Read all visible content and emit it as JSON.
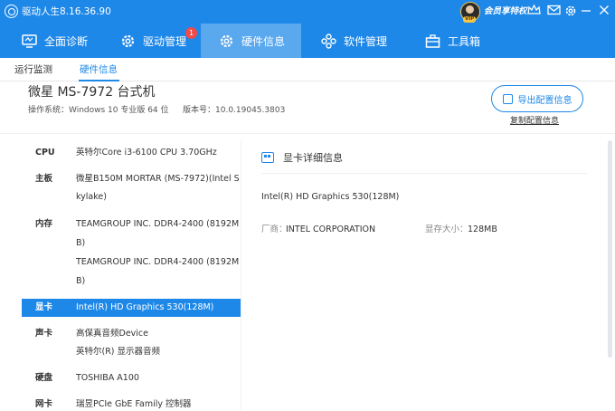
{
  "app": {
    "title": "驱动人生8.16.36.90",
    "member_label": "会员享特权",
    "vip_label": "VIP"
  },
  "window_icons": [
    "crown-icon",
    "mail-icon",
    "gear-icon",
    "minimize-icon",
    "close-icon"
  ],
  "nav": {
    "items": [
      {
        "label": "全面诊断",
        "icon": "monitor-icon"
      },
      {
        "label": "驱动管理",
        "icon": "gear-icon",
        "badge": "1"
      },
      {
        "label": "硬件信息",
        "icon": "gear-icon",
        "active": true
      },
      {
        "label": "软件管理",
        "icon": "apps-icon"
      },
      {
        "label": "工具箱",
        "icon": "toolbox-icon"
      }
    ]
  },
  "subnav": {
    "tabs": [
      "运行监测",
      "硬件信息"
    ],
    "active": "硬件信息"
  },
  "header": {
    "machine": "微星 MS-7972 台式机",
    "os": "操作系统：Windows 10 专业版 64 位",
    "version": "版本号：10.0.19045.3803",
    "export_label": "导出配置信息",
    "copy_label": "复制配置信息"
  },
  "hardware": [
    {
      "label": "CPU",
      "lines": [
        "英特尔Core i3-6100 CPU 3.70GHz"
      ]
    },
    {
      "label": "主板",
      "lines": [
        "微星B150M MORTAR (MS-7972)(Intel S",
        "kylake)"
      ]
    },
    {
      "label": "内存",
      "lines": [
        "TEAMGROUP INC. DDR4-2400 (8192M",
        "B)",
        "TEAMGROUP INC. DDR4-2400 (8192M",
        "B)"
      ]
    },
    {
      "label": "显卡",
      "lines": [
        "Intel(R) HD Graphics 530(128M)"
      ],
      "selected": true
    },
    {
      "label": "声卡",
      "lines": [
        "高保真音频Device",
        "英特尔(R) 显示器音频"
      ]
    },
    {
      "label": "硬盘",
      "lines": [
        "TOSHIBA A100"
      ]
    },
    {
      "label": "网卡",
      "lines": [
        "瑞昱PCIe GbE Family 控制器"
      ]
    }
  ],
  "detail": {
    "title": "显卡详细信息",
    "name": "Intel(R) HD Graphics 530(128M)",
    "vendor_key": "厂商：",
    "vendor": "INTEL CORPORATION",
    "memory_key": "显存大小：",
    "memory": "128MB"
  },
  "colors": {
    "brand": "#1e88e8",
    "active_nav": "#5aa8ee",
    "badge": "#ef4b4b"
  }
}
